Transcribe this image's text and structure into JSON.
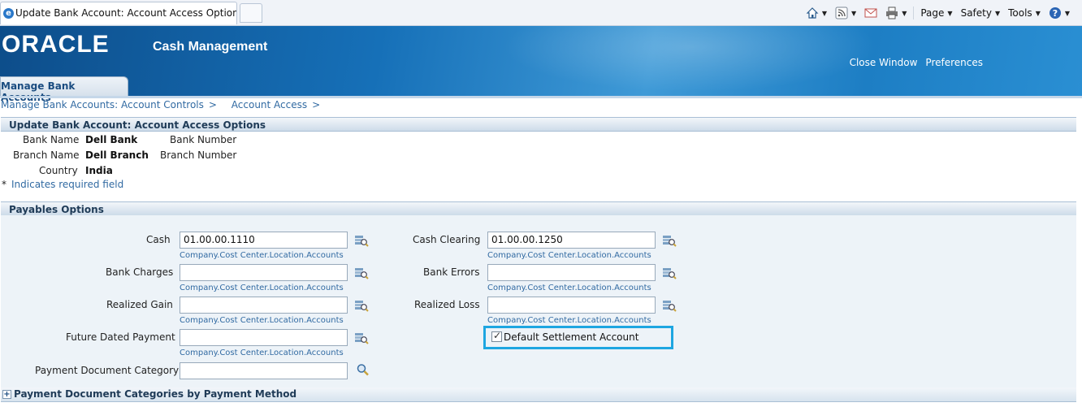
{
  "browser": {
    "tab_title": "Update Bank Account: Account Access Options",
    "toolbar": {
      "page_label": "Page",
      "safety_label": "Safety",
      "tools_label": "Tools",
      "icons": [
        "home-icon",
        "feed-icon",
        "mail-icon",
        "print-icon",
        "help-icon"
      ]
    }
  },
  "banner": {
    "logo": "ORACLE",
    "app_name": "Cash Management",
    "links": {
      "close_window": "Close Window",
      "preferences": "Preferences"
    },
    "subtab": "Manage Bank Accounts"
  },
  "breadcrumbs": [
    "Manage Bank Accounts: Account Controls",
    "Account Access"
  ],
  "breadcrumb_sep": ">",
  "header": {
    "title": "Update Bank Account: Account Access Options"
  },
  "bank_info": {
    "bank_name_label": "Bank Name",
    "bank_name": "Dell Bank",
    "bank_number_label": "Bank Number",
    "branch_name_label": "Branch Name",
    "branch_name": "Dell Branch",
    "branch_number_label": "Branch Number",
    "country_label": "Country",
    "country": "India",
    "required_note": "Indicates required field",
    "required_star": "*"
  },
  "payables": {
    "title": "Payables Options",
    "hint": "Company.Cost Center.Location.Accounts",
    "fields": {
      "cash": {
        "label": "Cash",
        "value": "01.00.00.1110"
      },
      "cash_clearing": {
        "label": "Cash Clearing",
        "value": "01.00.00.1250"
      },
      "bank_charges": {
        "label": "Bank Charges",
        "value": ""
      },
      "bank_errors": {
        "label": "Bank Errors",
        "value": ""
      },
      "realized_gain": {
        "label": "Realized Gain",
        "value": ""
      },
      "realized_loss": {
        "label": "Realized Loss",
        "value": ""
      },
      "future_dated_payment": {
        "label": "Future Dated Payment",
        "value": ""
      },
      "payment_document_category": {
        "label": "Payment Document Category",
        "value": ""
      }
    },
    "default_settlement": {
      "label": "Default Settlement Account",
      "checked": true
    }
  },
  "footer_section": {
    "title": "Payment Document Categories by Payment Method",
    "expander": "+"
  },
  "colors": {
    "banner": "#1670b8",
    "link": "#316aa2",
    "highlight": "#1ea6e1"
  }
}
